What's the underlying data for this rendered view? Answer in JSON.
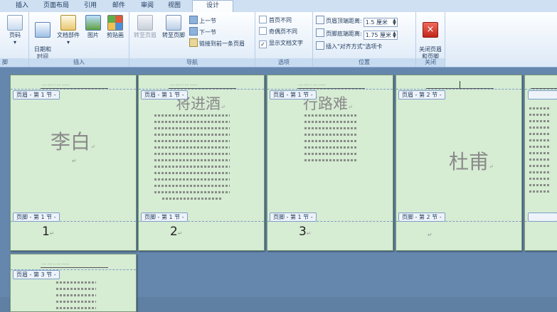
{
  "tabs": [
    "插入",
    "页面布局",
    "引用",
    "邮件",
    "审阅",
    "视图",
    "设计"
  ],
  "ribbon": {
    "partial_group": {
      "button": "页码",
      "label": "脚"
    },
    "insert": {
      "label": "插入",
      "buttons": [
        "日期和\n时间",
        "文档部件",
        "图片",
        "剪贴画"
      ]
    },
    "nav": {
      "label": "导航",
      "goto_header": "转至页眉",
      "goto_footer": "转至页脚",
      "prev": "上一节",
      "next": "下一节",
      "link_prev": "链接到前一条页眉"
    },
    "options": {
      "label": "选项",
      "items": [
        {
          "label": "首页不同",
          "checked": false
        },
        {
          "label": "奇偶页不同",
          "checked": false
        },
        {
          "label": "显示文档文字",
          "checked": true
        }
      ]
    },
    "position": {
      "label": "位置",
      "header_dist_label": "页眉顶端距离:",
      "header_dist_value": "1.5 厘米",
      "footer_dist_label": "页脚底端距离:",
      "footer_dist_value": "1.75 厘米",
      "align_tab": "插入\"对齐方式\"选项卡"
    },
    "close": {
      "label": "关闭",
      "button": "关闭页眉\n和页脚"
    }
  },
  "pages": [
    {
      "header": "页眉 - 第 1 节 -",
      "footer": "页脚 - 第 1 节 -",
      "title": "李白",
      "number": "1"
    },
    {
      "header": "页眉 - 第 1 节 -",
      "footer": "页脚 - 第 1 节 -",
      "title": "将进酒",
      "number": "2"
    },
    {
      "header": "页眉 - 第 1 节 -",
      "footer": "页脚 - 第 1 节 -",
      "title": "行路难",
      "number": "3"
    },
    {
      "header": "页眉 - 第 2 节 -",
      "footer": "页脚 - 第 2 节 -",
      "title": "杜甫",
      "number": ""
    },
    {
      "header": "页眉 - 第 3 节 -",
      "footer": "",
      "title": "",
      "number": ""
    }
  ],
  "return_mark": "↵"
}
